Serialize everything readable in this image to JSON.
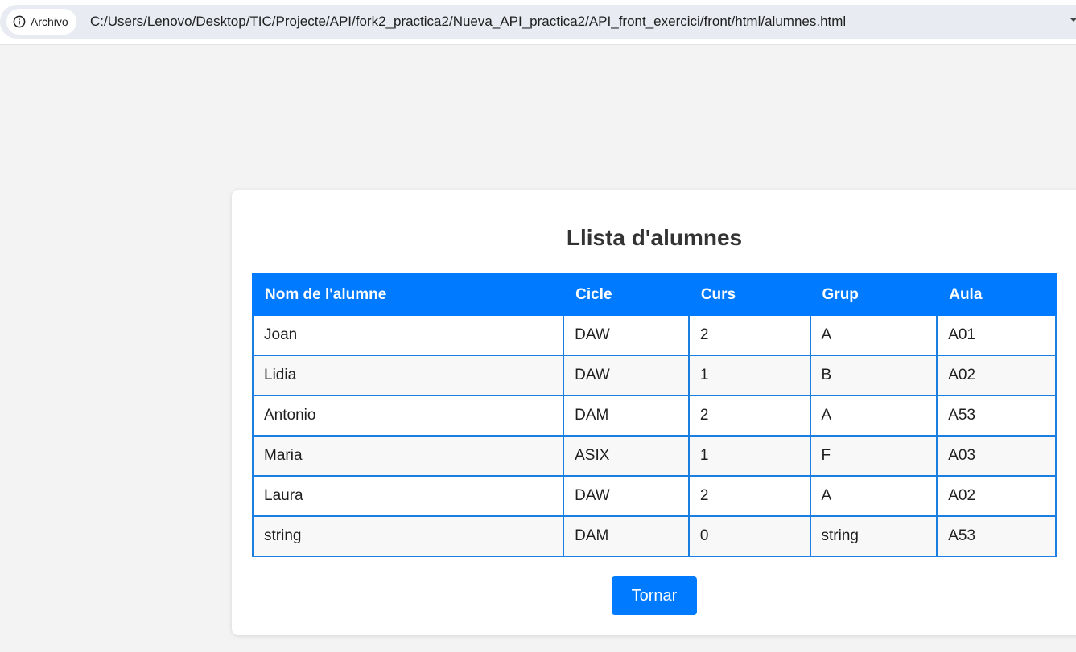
{
  "browser": {
    "site_info_label": "Archivo",
    "url": "C:/Users/Lenovo/Desktop/TIC/Projecte/API/fork2_practica2/Nueva_API_practica2/API_front_exercici/front/html/alumnes.html",
    "icons": {
      "site_info": "info-icon",
      "menu": "chevron-down-icon"
    }
  },
  "page": {
    "title": "Llista d'alumnes",
    "table": {
      "headers": [
        "Nom de l'alumne",
        "Cicle",
        "Curs",
        "Grup",
        "Aula"
      ],
      "rows": [
        [
          "Joan",
          "DAW",
          "2",
          "A",
          "A01"
        ],
        [
          "Lidia",
          "DAW",
          "1",
          "B",
          "A02"
        ],
        [
          "Antonio",
          "DAM",
          "2",
          "A",
          "A53"
        ],
        [
          "Maria",
          "ASIX",
          "1",
          "F",
          "A03"
        ],
        [
          "Laura",
          "DAW",
          "2",
          "A",
          "A02"
        ],
        [
          "string",
          "DAM",
          "0",
          "string",
          "A53"
        ]
      ]
    },
    "back_button": "Tornar"
  },
  "colors": {
    "accent": "#007bff",
    "page_background": "#f3f3f3",
    "card_background": "#ffffff",
    "title_text": "#333333"
  }
}
